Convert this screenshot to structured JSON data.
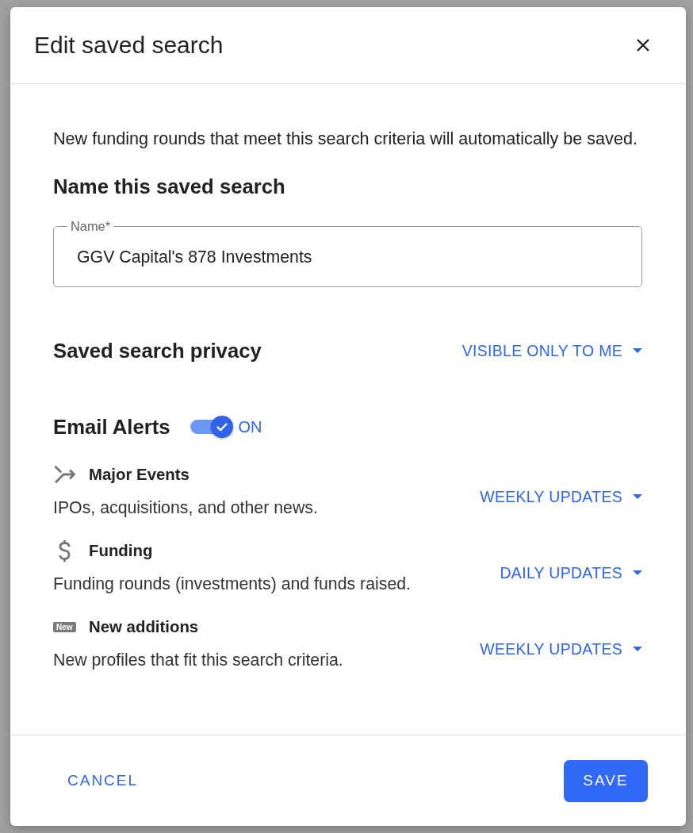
{
  "dialog": {
    "title": "Edit saved search"
  },
  "intro": "New funding rounds that meet this search criteria will automatically be saved.",
  "name_section": {
    "heading": "Name this saved search",
    "field": {
      "label": "Name*",
      "value": "GGV Capital's 878 Investments"
    }
  },
  "privacy": {
    "heading": "Saved search privacy",
    "dropdown": "VISIBLE ONLY TO ME"
  },
  "email_alerts": {
    "heading": "Email Alerts",
    "on": true,
    "state_label": "ON",
    "items": [
      {
        "kind": "events",
        "title": "Major Events",
        "description": "IPOs, acquisitions, and other news.",
        "frequency": "WEEKLY UPDATES"
      },
      {
        "kind": "funding",
        "title": "Funding",
        "description": "Funding rounds (investments) and funds raised.",
        "frequency": "DAILY UPDATES"
      },
      {
        "kind": "new",
        "badge": "New",
        "title": "New additions",
        "description": "New profiles that fit this search criteria.",
        "frequency": "WEEKLY UPDATES"
      }
    ]
  },
  "buttons": {
    "cancel": "CANCEL",
    "save": "SAVE"
  }
}
